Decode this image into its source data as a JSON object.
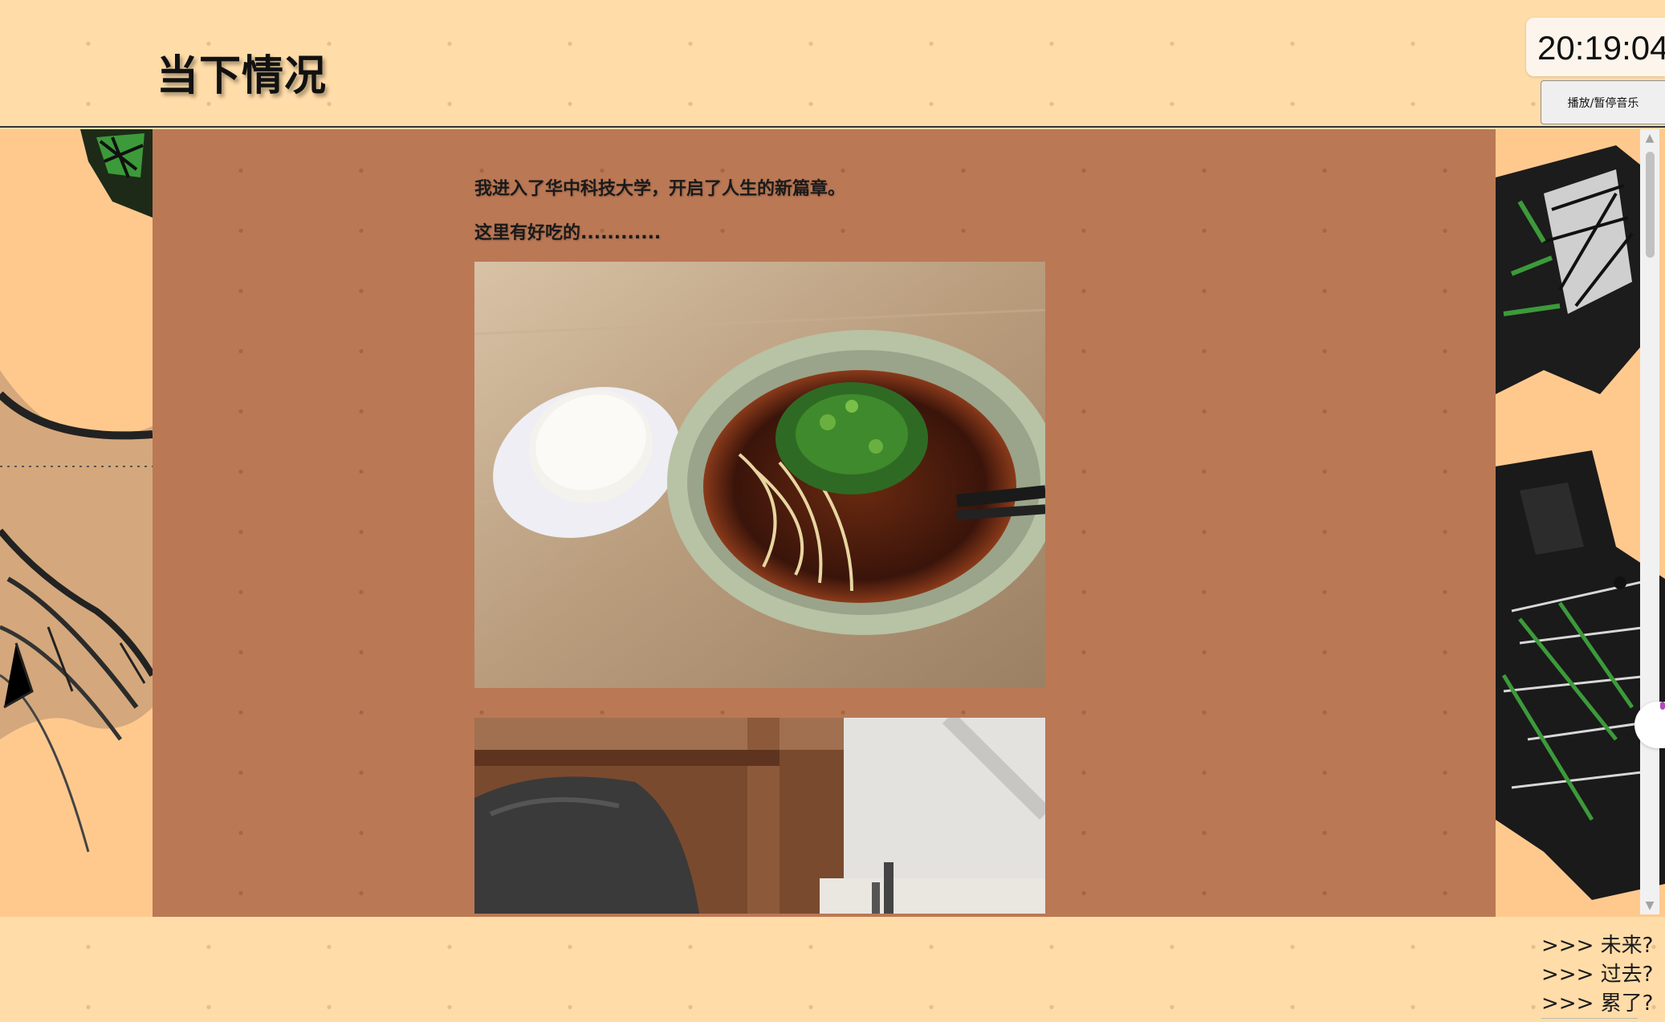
{
  "header": {
    "title": "当下情况",
    "clock": "20:19:04",
    "music_button_label": "播放/暂停音乐"
  },
  "article": {
    "paragraphs": [
      "我进入了华中科技大学，开启了人生的新篇章。",
      "这里有好吃的............"
    ]
  },
  "footer_nav": {
    "links": [
      ">>> 未来?",
      ">>> 过去?",
      ">>> 累了?"
    ]
  },
  "colors": {
    "page_background": "#ffdca8",
    "content_panel": "#bb7855",
    "text": "#1a1a1a"
  }
}
